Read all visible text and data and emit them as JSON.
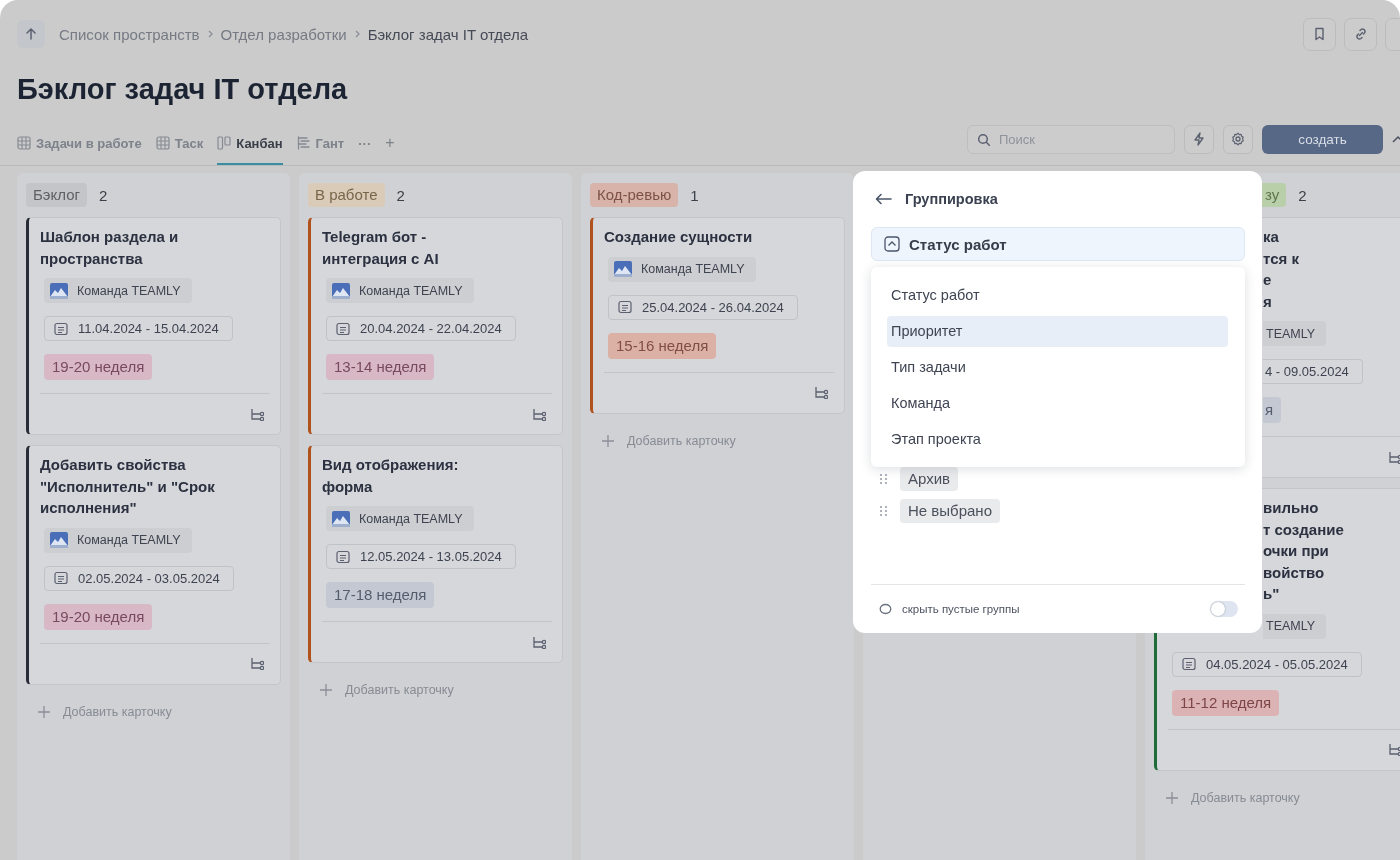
{
  "breadcrumb": [
    {
      "label": "Список пространств",
      "current": false
    },
    {
      "label": "Отдел разработки",
      "current": false
    },
    {
      "label": "Бэклог задач IT отдела",
      "current": true
    }
  ],
  "title": "Бэклог задач IT отдела",
  "tabs": [
    {
      "label": "Задачи в работе",
      "kind": "table",
      "selected": false
    },
    {
      "label": "Таск",
      "kind": "table",
      "selected": false
    },
    {
      "label": "Канбан",
      "kind": "kanban",
      "selected": true
    },
    {
      "label": "Гант",
      "kind": "gantt",
      "selected": false
    }
  ],
  "tabs_more": "···",
  "tabs_add": "+",
  "search": {
    "placeholder": "Поиск"
  },
  "create_button": "создать",
  "columns": [
    {
      "kind": "full",
      "label": "Бэклог",
      "count": "2",
      "color": "#c3c5c9",
      "add_card": "Добавить карточку",
      "cards": [
        {
          "kind": "full",
          "color": "#272c36",
          "title": "Шаблон раздела и\nпространства",
          "team": "Команда TEAMLY",
          "dates": "11.04.2024 - 15.04.2024",
          "week": {
            "label": "19-20 неделя",
            "color": "#d9b8c6"
          }
        },
        {
          "kind": "full",
          "color": "#272c36",
          "title": "Добавить свойства\n\"Исполнитель\" и \"Срок\nисполнения\"",
          "team": "Команда TEAMLY",
          "dates": "02.05.2024 - 03.05.2024",
          "week": {
            "label": "19-20 неделя",
            "color": "#d9b8c6"
          }
        }
      ]
    },
    {
      "kind": "full",
      "label": "В работе",
      "count": "2",
      "color": "#d9cbb8",
      "add_card": "Добавить карточку",
      "cards": [
        {
          "kind": "full",
          "color": "#b0521c",
          "title": "Telegram бот -\nинтеграция с AI",
          "team": "Команда TEAMLY",
          "dates": "20.04.2024 - 22.04.2024",
          "week": {
            "label": "13-14 неделя",
            "color": "#d9b8c6"
          }
        },
        {
          "kind": "full",
          "color": "#b0521c",
          "title": "Вид отображения:\nформа",
          "team": "Команда TEAMLY",
          "dates": "12.05.2024 - 13.05.2024",
          "week": {
            "label": "17-18 неделя",
            "color": "#c3c8d3"
          }
        }
      ]
    },
    {
      "kind": "full",
      "label": "Код-ревью",
      "count": "1",
      "color": "#d8b3a9",
      "add_card": "Добавить карточку",
      "cards": [
        {
          "kind": "full",
          "color": "#b0521c",
          "title": "Создание сущности",
          "team": "Команда TEAMLY",
          "dates": "25.04.2024 - 26.04.2024",
          "week": {
            "label": "15-16 неделя",
            "color": "#dbb1a6"
          }
        }
      ]
    },
    {
      "kind": "hidden"
    },
    {
      "kind": "partial",
      "label": "зу",
      "count": "2",
      "color": "#b9cfa9",
      "add_card": "Добавить карточку",
      "cards": [
        {
          "kind": "covered",
          "title": "ка\nтся к\nе\nя",
          "team": "TEAMLY",
          "dates": "4 - 09.05.2024",
          "week": {
            "label": "я",
            "color": "#c3c8d3"
          }
        },
        {
          "kind": "half",
          "color": "#1f6b3a",
          "title": "вильно\nт создание\nочки при\nвойство\nь\"",
          "team": "TEAMLY",
          "dates": "04.05.2024 - 05.05.2024",
          "week": {
            "label": "11-12 неделя",
            "color": "#dcb3b5"
          }
        }
      ]
    }
  ],
  "popup": {
    "title": "Группировка",
    "value": "Статус работ",
    "options": [
      {
        "label": "Статус работ",
        "highlighted": false
      },
      {
        "label": "Приоритет",
        "highlighted": true
      },
      {
        "label": "Тип задачи",
        "highlighted": false
      },
      {
        "label": "Команда",
        "highlighted": false
      },
      {
        "label": "Этап проекта",
        "highlighted": false
      }
    ],
    "groups": [
      {
        "label": "Архив"
      },
      {
        "label": "Не выбрано"
      }
    ],
    "hide_empty": {
      "label": "скрыть пустые группы",
      "on": false
    }
  }
}
